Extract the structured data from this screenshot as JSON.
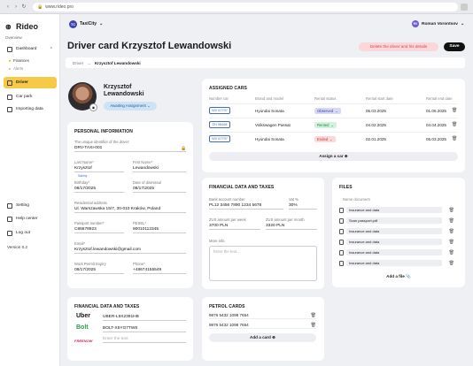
{
  "browser": {
    "url": "www.rideo.pro"
  },
  "sidebar": {
    "logo": "Rideo",
    "overview": "Overview",
    "items": [
      {
        "label": "Dashboard"
      },
      {
        "label": "Finances"
      },
      {
        "label": "Alerts"
      },
      {
        "label": "Driver"
      },
      {
        "label": "Car park"
      },
      {
        "label": "Importing data"
      },
      {
        "label": "Setting"
      },
      {
        "label": "Help center"
      },
      {
        "label": "Log out"
      }
    ],
    "version": "Version 0.2"
  },
  "topbar": {
    "company": "TaxiCity",
    "company_badge": "TC",
    "user": "Roman Vorontsov",
    "user_initials": "RV"
  },
  "header": {
    "title": "Driver card Krzysztof Lewandowski",
    "delete_label": "Delete the driver and his details",
    "save_label": "Save",
    "breadcrumb": {
      "parent": "Driver",
      "current": "Krzysztof Lewandowski"
    }
  },
  "profile": {
    "first": "Krzysztof",
    "last": "Lewandowski",
    "status": "Awaiting Assignment"
  },
  "personal": {
    "title": "PERSONAL INFORMATION",
    "uid_label": "The unique identifier of the driver:",
    "uid": "DRV-TAXI-001",
    "last_name_label": "Last Name*",
    "last_name": "Krzysztof",
    "last_name_hint": "Sabiny",
    "first_name_label": "First Name*",
    "first_name": "Lewandowski",
    "birthday_label": "Birthday*",
    "birthday": "08/17/2025",
    "dismissal_label": "Date of dismissal",
    "dismissal": "08/17/2025",
    "address_label": "Residential address",
    "address": "Ul. Warszawska 15/7, 30-010 Kraków, Poland",
    "passport_label": "Passport number*",
    "passport": "C85678923",
    "pesel_label": "PESEL*",
    "pesel": "90010112345",
    "email_label": "Email*",
    "email": "Krzysztof.lewandowski@gmail.com",
    "permit_label": "Work Permit Expiry",
    "permit": "08/17/2025",
    "phone_label": "Phone*",
    "phone": "+48674155549"
  },
  "cars": {
    "title": "ASSIGNED CARS",
    "headers": [
      "Number car",
      "Brand and model",
      "Rental status",
      "Rental start date",
      "Rental end date"
    ],
    "rows": [
      {
        "plate": "WV 67797",
        "model": "Hyundai Sonata",
        "status": "Observed",
        "start": "05.03.2025",
        "end": "01.06.2025"
      },
      {
        "plate": "ZH 96448",
        "model": "Volkswagen Passat",
        "status": "Rented",
        "start": "04.02.2025",
        "end": "04.04.2025"
      },
      {
        "plate": "WV 67797",
        "model": "Hyundai Sonata",
        "status": "Ended",
        "start": "02.01.2025",
        "end": "05.03.2025"
      }
    ],
    "assign_label": "Assign a car"
  },
  "finance": {
    "title": "FINANCIAL DATA AND TAXES",
    "bank_label": "Bank account number",
    "bank": "PL12 3456 7890 1234 5678",
    "vat_label": "Vat %",
    "vat": "30%",
    "zus_week_label": "ZUS amount per week",
    "zus_week": "3700 PLN",
    "zus_month_label": "ZUS amount per month",
    "zus_month": "3320 PLN",
    "more_label": "More info",
    "more_placeholder": "Enter the text..."
  },
  "files": {
    "title": "FILES",
    "name_header": "Name document",
    "items": [
      "Insurance and data",
      "Scan passport.pdf",
      "Insurance and data",
      "Insurance and data",
      "Insurance and data",
      "Insurance and data"
    ],
    "add_label": "Add a file"
  },
  "finance2": {
    "title": "FINANCIAL DATA AND TAXES",
    "uber": "Uber",
    "uber_id": "UBER-L9X2391HB",
    "bolt": "Bolt",
    "bolt_id": "BOLT-X5YG7TW8",
    "freenow": "FREENOW",
    "freenow_placeholder": "Enter the text"
  },
  "petrol": {
    "title": "PETROL CARDS",
    "cards": [
      "9876 5432 1098 7654",
      "9876 5432 1098 7654"
    ],
    "add_label": "Add a card"
  }
}
